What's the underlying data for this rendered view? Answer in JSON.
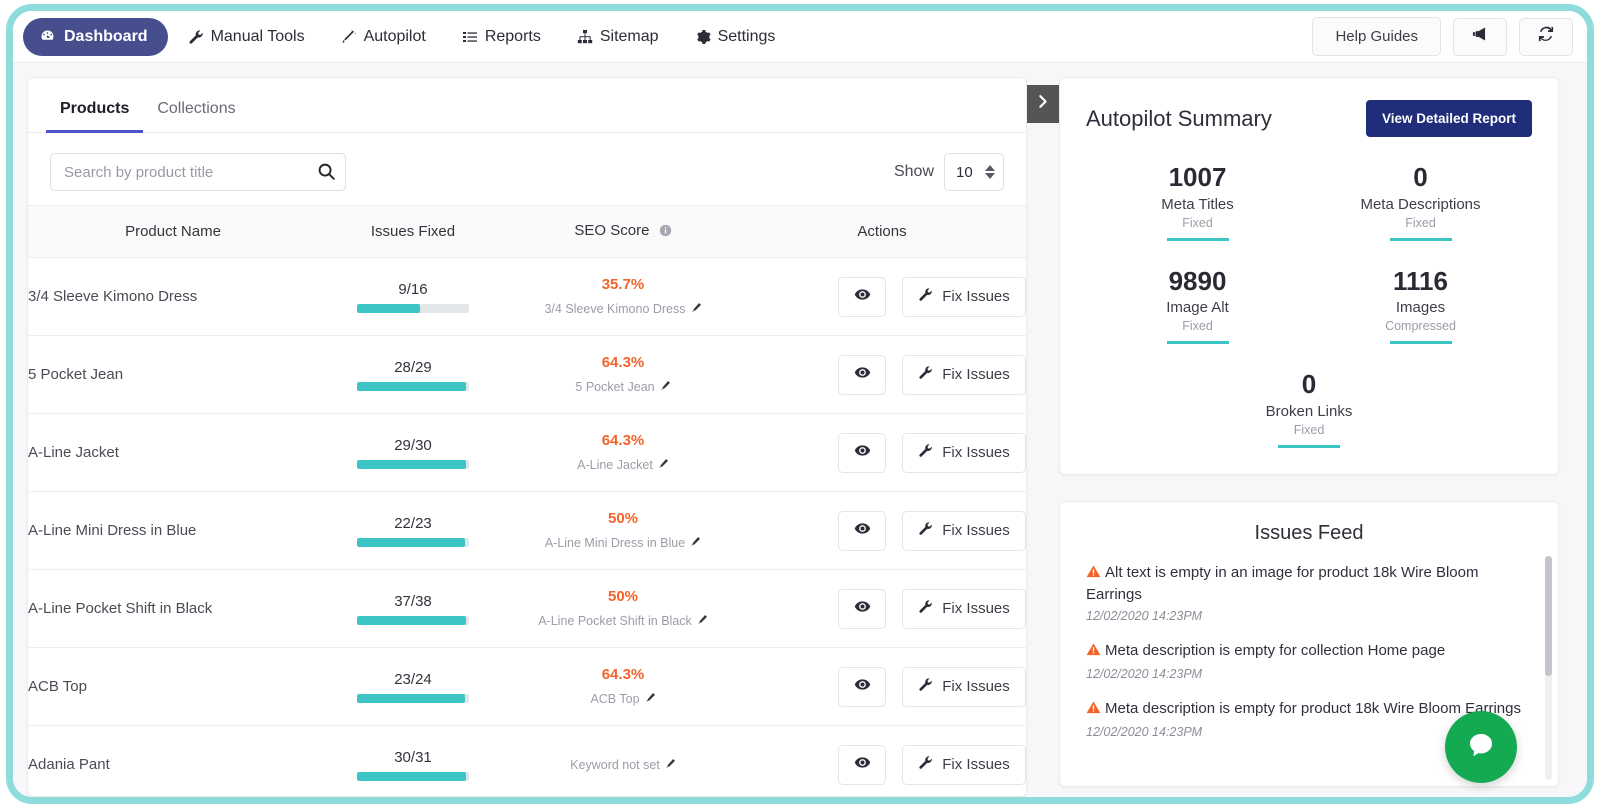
{
  "nav": {
    "brand_item": {
      "label": "Dashboard",
      "icon": "dashboard-gauge-icon"
    },
    "items": [
      {
        "label": "Manual Tools",
        "icon": "wrench-icon"
      },
      {
        "label": "Autopilot",
        "icon": "magic-wand-icon"
      },
      {
        "label": "Reports",
        "icon": "list-icon"
      },
      {
        "label": "Sitemap",
        "icon": "sitemap-icon"
      },
      {
        "label": "Settings",
        "icon": "gear-icon"
      }
    ],
    "help_guides": "Help Guides",
    "announce_icon": "megaphone-icon",
    "refresh_icon": "refresh-icon"
  },
  "left_panel": {
    "tabs": [
      {
        "label": "Products",
        "active": true
      },
      {
        "label": "Collections",
        "active": false
      }
    ],
    "search": {
      "placeholder": "Search by product title",
      "value": "",
      "icon": "search-icon"
    },
    "show": {
      "label": "Show",
      "value": "10",
      "icon": "stepper-icon"
    },
    "table": {
      "columns": [
        "Product Name",
        "Issues Fixed",
        "SEO Score",
        "Actions"
      ],
      "seo_info_icon": "info-icon",
      "rows": [
        {
          "name": "3/4 Sleeve Kimono Dress",
          "fixed": "9/16",
          "pct": 56,
          "seo_pct": "35.7%",
          "keyword": "3/4 Sleeve Kimono Dress",
          "view_icon": "eye-icon",
          "fix_label": "Fix Issues",
          "fix_icon": "wrench-icon"
        },
        {
          "name": "5 Pocket Jean",
          "fixed": "28/29",
          "pct": 97,
          "seo_pct": "64.3%",
          "keyword": "5 Pocket Jean",
          "view_icon": "eye-icon",
          "fix_label": "Fix Issues",
          "fix_icon": "wrench-icon"
        },
        {
          "name": "A-Line Jacket",
          "fixed": "29/30",
          "pct": 97,
          "seo_pct": "64.3%",
          "keyword": "A-Line Jacket",
          "view_icon": "eye-icon",
          "fix_label": "Fix Issues",
          "fix_icon": "wrench-icon"
        },
        {
          "name": "A-Line Mini Dress in Blue",
          "fixed": "22/23",
          "pct": 96,
          "seo_pct": "50%",
          "keyword": "A-Line Mini Dress in Blue",
          "view_icon": "eye-icon",
          "fix_label": "Fix Issues",
          "fix_icon": "wrench-icon"
        },
        {
          "name": "A-Line Pocket Shift in Black",
          "fixed": "37/38",
          "pct": 97,
          "seo_pct": "50%",
          "keyword": "A-Line Pocket Shift in Black",
          "view_icon": "eye-icon",
          "fix_label": "Fix Issues",
          "fix_icon": "wrench-icon"
        },
        {
          "name": "ACB Top",
          "fixed": "23/24",
          "pct": 96,
          "seo_pct": "64.3%",
          "keyword": "ACB Top",
          "view_icon": "eye-icon",
          "fix_label": "Fix Issues",
          "fix_icon": "wrench-icon"
        },
        {
          "name": "Adania Pant",
          "fixed": "30/31",
          "pct": 97,
          "seo_pct": "",
          "keyword": "Keyword not set",
          "view_icon": "eye-icon",
          "fix_label": "Fix Issues",
          "fix_icon": "wrench-icon"
        }
      ]
    }
  },
  "right_panel": {
    "collapse_icon": "chevron-right-icon",
    "summary": {
      "title": "Autopilot Summary",
      "report_button": "View Detailed Report",
      "stats": [
        {
          "value": "1007",
          "label": "Meta Titles",
          "sub": "Fixed"
        },
        {
          "value": "0",
          "label": "Meta Descriptions",
          "sub": "Fixed"
        },
        {
          "value": "9890",
          "label": "Image Alt",
          "sub": "Fixed"
        },
        {
          "value": "1116",
          "label": "Images",
          "sub": "Compressed"
        },
        {
          "value": "0",
          "label": "Broken Links",
          "sub": "Fixed"
        }
      ]
    },
    "issues_feed": {
      "title": "Issues Feed",
      "warn_icon": "warning-triangle-icon",
      "items": [
        {
          "text": "Alt text is empty in an image for product 18k Wire Bloom Earrings",
          "time": "12/02/2020 14:23PM"
        },
        {
          "text": "Meta description is empty for collection Home page",
          "time": "12/02/2020 14:23PM"
        },
        {
          "text": "Meta description is empty for product 18k Wire Bloom Earrings",
          "time": "12/02/2020 14:23PM"
        }
      ]
    }
  },
  "chat_widget": {
    "icon": "chat-bubble-icon"
  },
  "colors": {
    "frame_teal": "#8fdcdc",
    "brand_indigo": "#474e8e",
    "tab_accent": "#4c54c8",
    "progress_teal": "#3dc4c4",
    "seo_orange": "#f4632a",
    "report_navy": "#1f2d7a",
    "chat_green": "#14aa52",
    "warn_orange": "#f4632a"
  }
}
